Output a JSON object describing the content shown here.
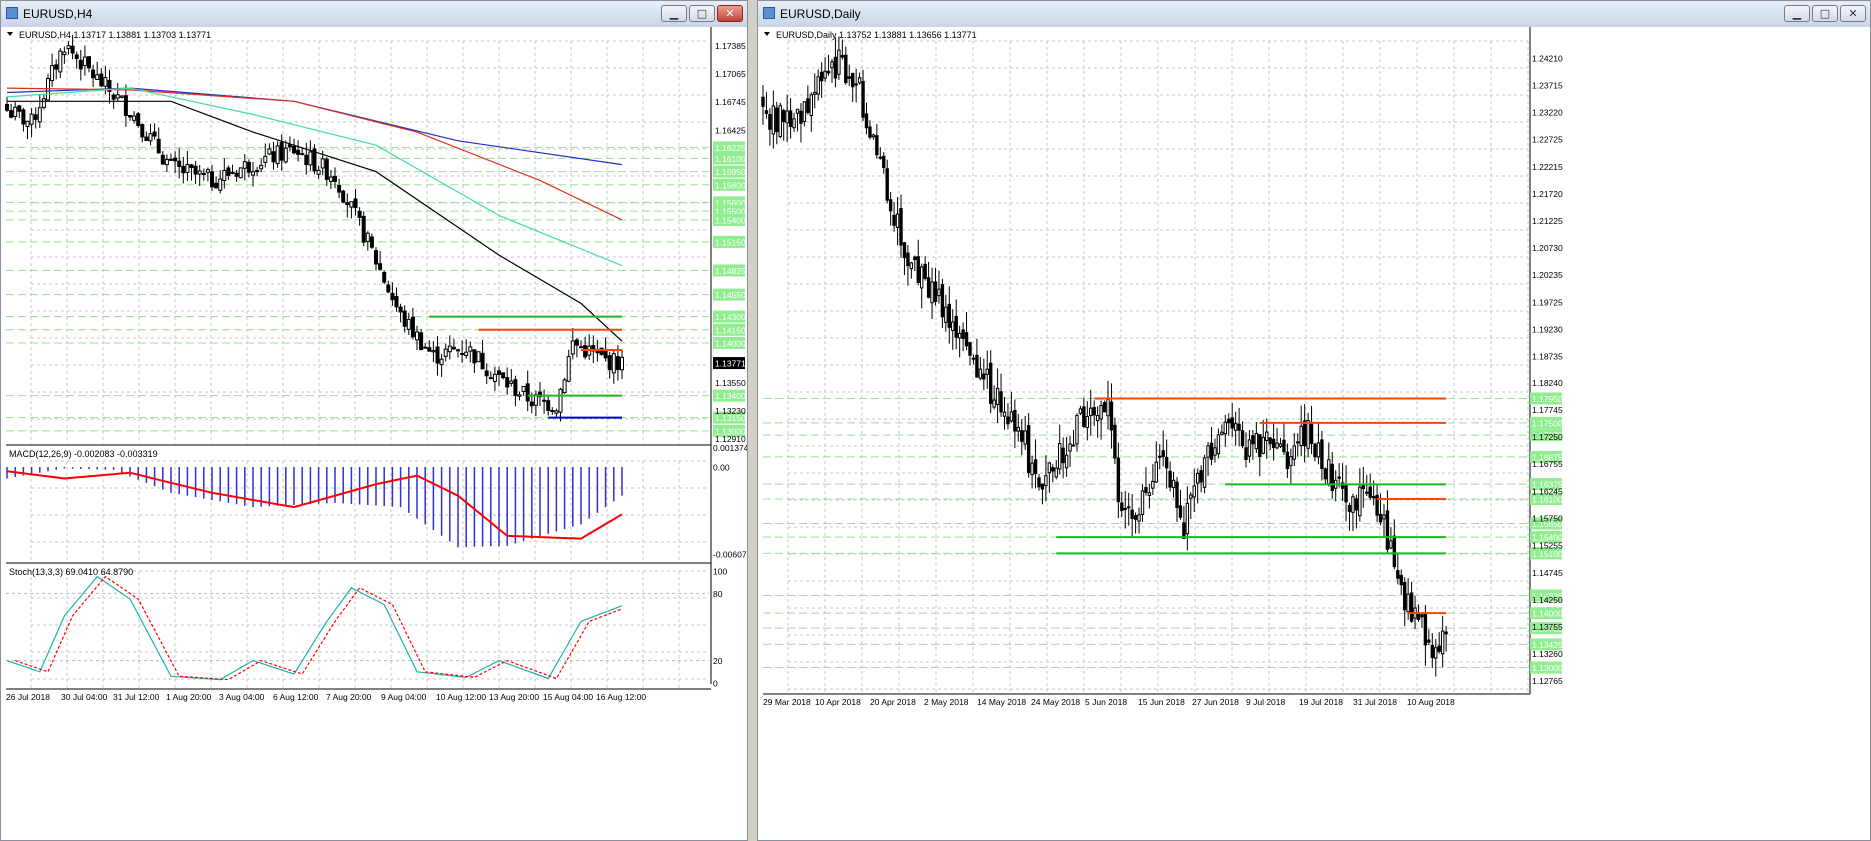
{
  "windows": {
    "h4": {
      "title": "EURUSD,H4",
      "info": "EURUSD,H4  1.13717 1.13881 1.13703 1.13771",
      "price_ticks": [
        "1.17385",
        "1.17065",
        "1.16745",
        "1.16425",
        "1.16225",
        "1.16100",
        "1.15950",
        "1.15800",
        "1.15600",
        "1.15500",
        "1.15400",
        "1.15150",
        "1.14825",
        "1.14550",
        "1.14300",
        "1.14150",
        "1.14000",
        "1.13771",
        "1.13550",
        "1.13400",
        "1.13230",
        "1.13150",
        "1.13000",
        "1.12910"
      ],
      "level_labels": [
        "1.16225",
        "1.16100",
        "1.15950",
        "1.15800",
        "1.15600",
        "1.15500",
        "1.15400",
        "1.15150",
        "1.14825",
        "1.14550",
        "1.14300",
        "1.14150",
        "1.14000",
        "1.13400",
        "1.13150",
        "1.13000"
      ],
      "current_price": "1.13771",
      "time_labels": [
        "26 Jul 2018",
        "30 Jul 04:00",
        "31 Jul 12:00",
        "1 Aug 20:00",
        "3 Aug 04:00",
        "6 Aug 12:00",
        "7 Aug 20:00",
        "9 Aug 04:00",
        "10 Aug 12:00",
        "13 Aug 20:00",
        "15 Aug 04:00",
        "16 Aug 12:00"
      ],
      "macd": {
        "label": "MACD(12,26,9) -0.002083 -0.003319",
        "ticks": [
          "0.001374",
          "0.00",
          "-0.006077"
        ]
      },
      "stoch": {
        "label": "Stoch(13,3,3) 69.0410 64.8790",
        "ticks": [
          "100",
          "80",
          "20",
          "0"
        ]
      }
    },
    "daily": {
      "title": "EURUSD,Daily",
      "info": "EURUSD,Daily  1.13752 1.13881 1.13656 1.13771",
      "price_ticks": [
        "1.24210",
        "1.23715",
        "1.23220",
        "1.22725",
        "1.22215",
        "1.21720",
        "1.21225",
        "1.20730",
        "1.20235",
        "1.19725",
        "1.19230",
        "1.18735",
        "1.18240",
        "1.17745",
        "1.17250",
        "1.16755",
        "1.16245",
        "1.15750",
        "1.15255",
        "1.14745",
        "1.14250",
        "1.13755",
        "1.13260",
        "1.12765"
      ],
      "level_labels": [
        "1.17950",
        "1.17500",
        "1.17275",
        "1.16875",
        "1.16375",
        "1.16100",
        "1.15650",
        "1.15400",
        "1.15100",
        "1.14325",
        "1.14000",
        "1.13725",
        "1.13425",
        "1.13000"
      ],
      "time_labels": [
        "29 Mar 2018",
        "10 Apr 2018",
        "20 Apr 2018",
        "2 May 2018",
        "14 May 2018",
        "24 May 2018",
        "5 Jun 2018",
        "15 Jun 2018",
        "27 Jun 2018",
        "9 Jul 2018",
        "19 Jul 2018",
        "31 Jul 2018",
        "10 Aug 2018"
      ]
    }
  },
  "window_buttons": {
    "minimize": "▁",
    "maximize": "□",
    "close": "✕"
  },
  "colors": {
    "bull": "#ffffff",
    "bear": "#000000",
    "resistance": "#ff4500",
    "support": "#22b522",
    "support_blue": "#0000cd",
    "level_label_bg": "#90ee90",
    "macd_hist": "#3030d0",
    "macd_signal": "#ff0000",
    "stoch_main": "#20b2aa",
    "stoch_signal": "#ff0000",
    "ma_black": "#000000",
    "ma_green": "#40e0a0",
    "ma_red": "#e03020",
    "ma_blue": "#2030c0"
  }
}
